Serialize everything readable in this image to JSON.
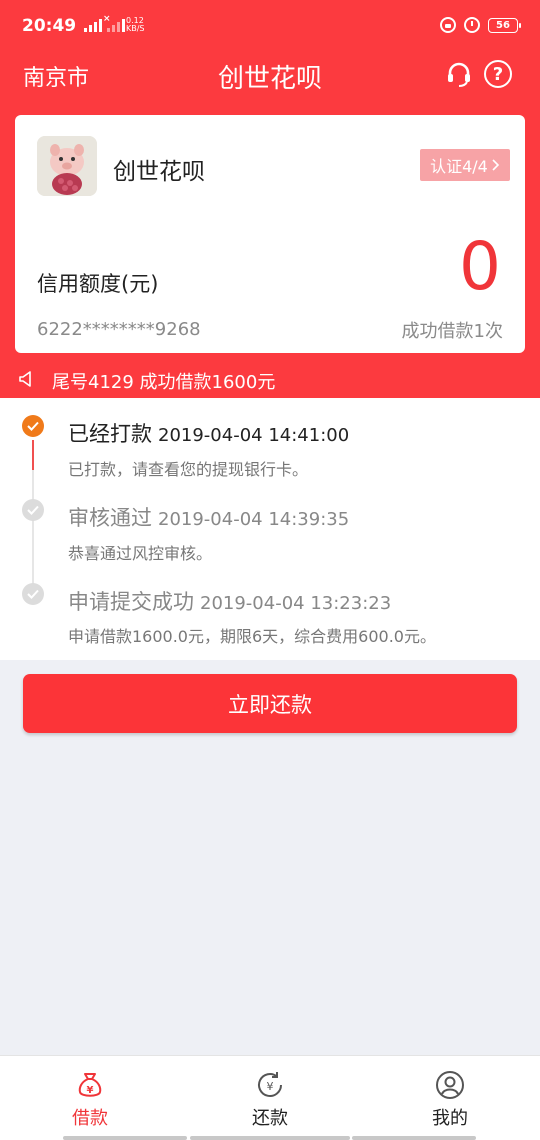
{
  "status_bar": {
    "time": "20:49",
    "network": "⁴⁶4G",
    "net_speed_value": "0.12",
    "net_speed_unit": "KB/S",
    "battery": "56"
  },
  "header": {
    "city": "南京市",
    "title": "创世花呗"
  },
  "card": {
    "name": "创世花呗",
    "cert_label": "认证4/4",
    "credit_label": "信用额度(元)",
    "credit_value": "0",
    "card_number": "6222********9268",
    "success_text": "成功借款1次"
  },
  "notice": {
    "text": "尾号4129 成功借款1600元"
  },
  "timeline": [
    {
      "title": "已经打款",
      "time": "2019-04-04 14:41:00",
      "desc": "已打款，请查看您的提现银行卡。",
      "status": "done"
    },
    {
      "title": "审核通过",
      "time": "2019-04-04 14:39:35",
      "desc": "恭喜通过风控审核。",
      "status": "past"
    },
    {
      "title": "申请提交成功",
      "time": "2019-04-04 13:23:23",
      "desc": "申请借款1600.0元，期限6天，综合费用600.0元。",
      "status": "past"
    }
  ],
  "repay_button": "立即还款",
  "tabs": [
    {
      "label": "借款",
      "icon": "money-bag-icon",
      "active": true
    },
    {
      "label": "还款",
      "icon": "repay-cycle-icon",
      "active": false
    },
    {
      "label": "我的",
      "icon": "user-icon",
      "active": false
    }
  ],
  "colors": {
    "primary_red": "#fc3a3f",
    "done_orange": "#f07a1a",
    "badge_pink": "#f7a3a6"
  }
}
